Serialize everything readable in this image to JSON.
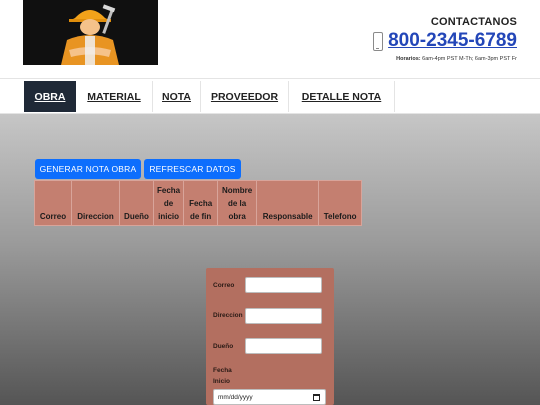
{
  "header": {
    "contact_title": "CONTACTANOS",
    "phone": "800-2345-6789",
    "hours_label": "Horarios:",
    "hours_text": "6am-4pm PST M-Th; 6am-3pm PST Fr"
  },
  "nav": {
    "items": [
      {
        "label": "OBRA"
      },
      {
        "label": "MATERIAL"
      },
      {
        "label": "NOTA"
      },
      {
        "label": "PROVEEDOR"
      },
      {
        "label": "DETALLE NOTA"
      }
    ]
  },
  "buttons": {
    "generar": "GENERAR NOTA OBRA",
    "refrescar": "REFRESCAR DATOS"
  },
  "table": {
    "headers": [
      "Correo",
      "Direccion",
      "Dueño",
      "Fecha de inicio",
      "Fecha de fin",
      "Nombre de la obra",
      "Responsable",
      "Telefono"
    ]
  },
  "form": {
    "correo_label": "Correo",
    "direccion_label": "Direccion",
    "dueno_label": "Dueño",
    "fecha_inicio_label": "Fecha Inicio",
    "date_placeholder": "mm/dd/yyyy"
  },
  "colors": {
    "accent": "#0d6efd",
    "nav_active": "#1f2937",
    "table_bg": "#c47f70",
    "form_bg": "#b36f60",
    "phone": "#2346b8"
  }
}
